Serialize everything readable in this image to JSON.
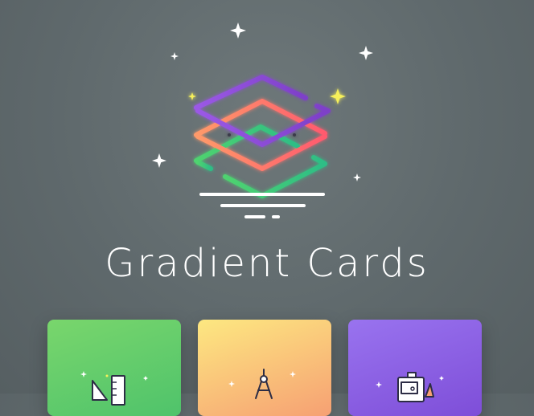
{
  "page": {
    "title": "Gradient Cards"
  },
  "colors": {
    "background": "#5f696c",
    "layer_top": "#8a4fd6",
    "layer_middle": "#ff6a6a",
    "layer_bottom": "#3ccf7a",
    "sparkle_white": "#ffffff",
    "sparkle_yellow": "#f6f05a",
    "card_green": "#5fce6b",
    "card_orange": "#f9c27a",
    "card_purple": "#8a5fe4"
  },
  "cards": [
    {
      "icon": "design-tools-icon",
      "color": "green"
    },
    {
      "icon": "compass-icon",
      "color": "orange"
    },
    {
      "icon": "drawing-tablet-icon",
      "color": "purple"
    }
  ]
}
